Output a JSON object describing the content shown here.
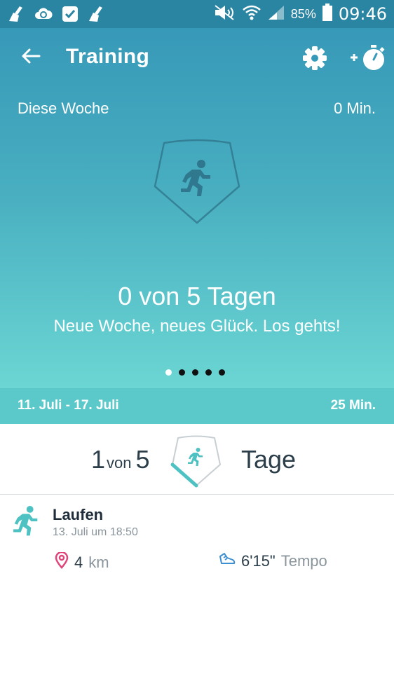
{
  "status_bar": {
    "battery_percent": "85%",
    "time": "09:46",
    "left_icons": [
      "clean-icon",
      "cloud-sync-icon",
      "check-box-icon",
      "clean-icon"
    ],
    "right_icons": [
      "mute-icon",
      "wifi-icon",
      "signal-icon",
      "battery-icon"
    ]
  },
  "appbar": {
    "title": "Training",
    "back_icon": "arrow-left-icon",
    "settings_icon": "gear-icon",
    "add_timer_icon": "add-stopwatch-icon"
  },
  "this_week": {
    "label": "Diese Woche",
    "minutes": "0 Min.",
    "days_progress": "0 von 5 Tagen",
    "motivation": "Neue Woche, neues Glück. Los gehts!"
  },
  "pager": {
    "total": 5,
    "active_index": 0
  },
  "week_bar": {
    "range": "11. Juli - 17. Juli",
    "minutes": "25 Min."
  },
  "summary": {
    "current": "1",
    "von": "von",
    "goal": "5",
    "unit": "Tage",
    "progress_fraction": 0.2
  },
  "activities": [
    {
      "name": "Laufen",
      "datetime": "13. Juli um 18:50",
      "distance_value": "4",
      "distance_unit": "km",
      "pace_value": "6'15\"",
      "pace_unit": "Tempo"
    }
  ],
  "colors": {
    "status_bar": "#2a85a3",
    "gradient_top": "#3799b8",
    "gradient_bottom": "#6bd6d3",
    "week_bar": "#5bc8c9",
    "accent_teal": "#4ec2c2",
    "location_pink": "#e0457b",
    "shoe_blue": "#3d8fd1"
  }
}
